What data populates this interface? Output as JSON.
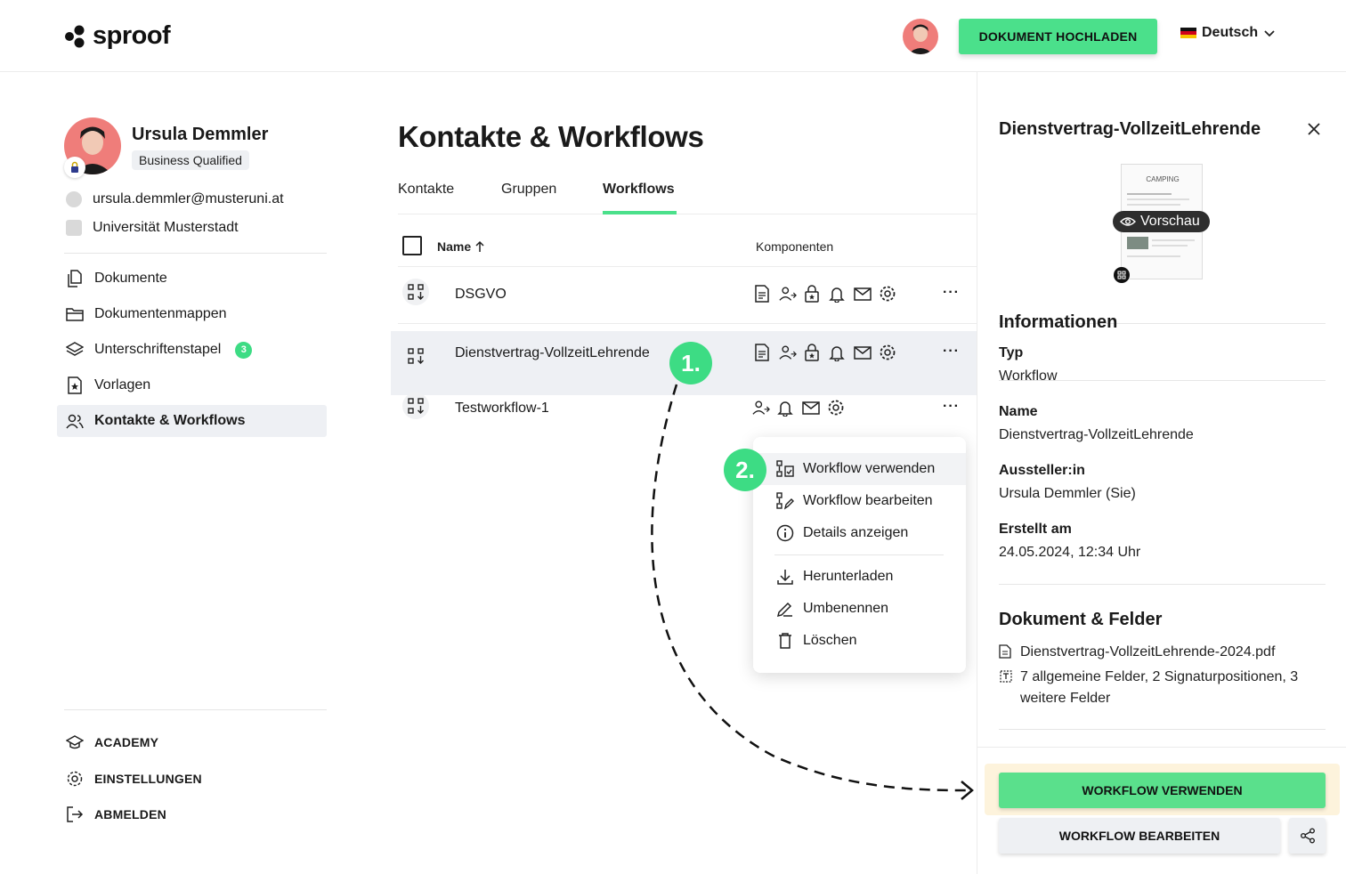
{
  "header": {
    "logo_text": "sproof",
    "upload_label": "DOKUMENT HOCHLADEN",
    "language": "Deutsch"
  },
  "colors": {
    "accent": "#4be08b",
    "step_badge": "#3ddc84",
    "selected_row": "#eef0f4",
    "highlight": "#fdf3dc"
  },
  "profile": {
    "name": "Ursula Demmler",
    "badge": "Business Qualified",
    "email": "ursula.demmler@musteruni.at",
    "organization": "Universität Musterstadt"
  },
  "sidebar": {
    "items": [
      {
        "label": "Dokumente",
        "icon": "documents-icon"
      },
      {
        "label": "Dokumentenmappen",
        "icon": "folder-icon"
      },
      {
        "label": "Unterschriftenstapel",
        "icon": "layers-icon",
        "count": "3"
      },
      {
        "label": "Vorlagen",
        "icon": "template-icon"
      },
      {
        "label": "Kontakte & Workflows",
        "icon": "contacts-icon",
        "active": true
      }
    ],
    "bottom": [
      {
        "label": "ACADEMY",
        "icon": "graduation-cap-icon"
      },
      {
        "label": "EINSTELLUNGEN",
        "icon": "gear-icon"
      },
      {
        "label": "ABMELDEN",
        "icon": "logout-icon"
      }
    ]
  },
  "main": {
    "title": "Kontakte & Workflows",
    "tabs": [
      {
        "label": "Kontakte"
      },
      {
        "label": "Gruppen"
      },
      {
        "label": "Workflows",
        "active": true
      }
    ],
    "table": {
      "col_name": "Name",
      "col_components": "Komponenten",
      "rows": [
        {
          "name": "DSGVO",
          "components": [
            "document",
            "signers",
            "lock",
            "bell",
            "mail",
            "gear"
          ]
        },
        {
          "name": "Dienstvertrag-VollzeitLehrende",
          "components": [
            "document",
            "signers",
            "lock",
            "bell",
            "mail",
            "gear"
          ],
          "selected": true
        },
        {
          "name": "Testworkflow-1",
          "components": [
            "signers",
            "bell",
            "mail",
            "gear"
          ]
        }
      ]
    },
    "steps": {
      "one": "1.",
      "two": "2."
    }
  },
  "context_menu": {
    "items": [
      {
        "label": "Workflow verwenden",
        "icon": "workflow-use-icon"
      },
      {
        "label": "Workflow bearbeiten",
        "icon": "workflow-edit-icon"
      },
      {
        "label": "Details anzeigen",
        "icon": "info-icon"
      },
      {
        "label": "Herunterladen",
        "icon": "download-icon"
      },
      {
        "label": "Umbenennen",
        "icon": "pencil-icon"
      },
      {
        "label": "Löschen",
        "icon": "trash-icon"
      }
    ]
  },
  "panel": {
    "title": "Dienstvertrag-VollzeitLehrende",
    "preview_label": "Vorschau",
    "preview_doc_heading": "CAMPING",
    "info_title": "Informationen",
    "type_label": "Typ",
    "type_value": "Workflow",
    "name_label": "Name",
    "name_value": "Dienstvertrag-VollzeitLehrende",
    "issuer_label": "Aussteller:in",
    "issuer_value": "Ursula Demmler (Sie)",
    "created_label": "Erstellt am",
    "created_value": "24.05.2024, 12:34 Uhr",
    "doc_title": "Dokument & Felder",
    "doc_file": "Dienstvertrag-VollzeitLehrende-2024.pdf",
    "doc_fields": "7 allgemeine Felder, 2 Signaturpositionen, 3 weitere Felder",
    "use_button": "WORKFLOW VERWENDEN",
    "edit_button": "WORKFLOW BEARBEITEN"
  }
}
